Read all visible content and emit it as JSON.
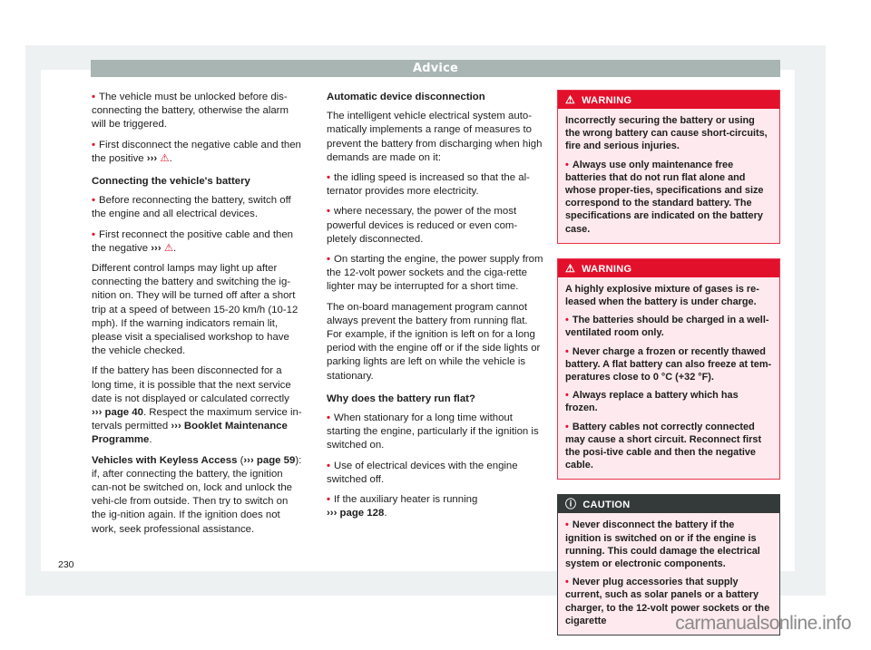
{
  "header": {
    "title": "Advice"
  },
  "left_column": {
    "bullets_top": [
      "The vehicle must be unlocked before dis-connecting the battery, otherwise the alarm will be triggered.",
      "First disconnect the negative cable and then the positive"
    ],
    "connecting_heading": "Connecting the vehicle's battery",
    "connecting_bullets": [
      "Before reconnecting the battery, switch off the engine and all electrical devices.",
      "First reconnect the positive cable and then the negative"
    ],
    "para_lamps": "Different control lamps may light up after connecting the battery and switching the ig-nition on. They will be turned off after a short trip at a speed of between 15-20 km/h (10-12 mph). If the warning indicators remain lit, please visit a specialised workshop to have the vehicle checked.",
    "para_service_1": "If the battery has been disconnected for a long time, it is possible that the next service date is not displayed or calculated correctly",
    "para_service_ref": "››› page 40",
    "para_service_2": ". Respect the maximum service in-tervals permitted",
    "para_service_ref2": "››› Booklet Maintenance Programme",
    "para_service_3": ".",
    "keyless_heading": "Vehicles with Keyless Access",
    "keyless_ref": "››› page 59",
    "keyless_text": "): if, after connecting the battery, the ignition can-not be switched on, lock and unlock the vehi-cle from outside. Then try to switch on the ig-nition again. If the ignition does not work, seek professional assistance.",
    "ref_arrow": "›››",
    "warn_symbol": "⚠"
  },
  "middle_column": {
    "auto_heading": "Automatic device disconnection",
    "auto_intro": "The intelligent vehicle electrical system auto-matically implements a range of measures to prevent the battery from discharging when high demands are made on it:",
    "auto_bullets": [
      "the idling speed is increased so that the al-ternator provides more electricity.",
      "where necessary, the power of the most powerful devices is reduced or even com-pletely disconnected.",
      "On starting the engine, the power supply from the 12-volt power sockets and the ciga-rette lighter may be interrupted for a short time."
    ],
    "mgmt_para": "The on-board management program cannot always prevent the battery from running flat. For example, if the ignition is left on for a long period with the engine off or if the side lights or parking lights are left on while the vehicle is stationary.",
    "flat_heading": "Why does the battery run flat?",
    "flat_bullets": [
      "When stationary for a long time without starting the engine, particularly if the ignition is switched on.",
      "Use of electrical devices with the engine switched off.",
      "If the auxiliary heater is running"
    ],
    "flat_ref": "››› page 128",
    "flat_ref_end": "."
  },
  "right_column": {
    "warning1": {
      "label": "WARNING",
      "icon": "⚠",
      "intro": "Incorrectly securing the battery or using the wrong battery can cause short-circuits, fire and serious injuries.",
      "bullets": [
        "Always use only maintenance free batteries that do not run flat alone and whose proper-ties, specifications and size correspond to the standard battery. The specifications are indicated on the battery case."
      ]
    },
    "warning2": {
      "label": "WARNING",
      "icon": "⚠",
      "intro": "A highly explosive mixture of gases is re-leased when the battery is under charge.",
      "bullets": [
        "The batteries should be charged in a well-ventilated room only.",
        "Never charge a frozen or recently thawed battery. A flat battery can also freeze at tem-peratures close to 0 °C (+32 °F).",
        "Always replace a battery which has frozen.",
        "Battery cables not correctly connected may cause a short circuit. Reconnect first the posi-tive cable and then the negative cable."
      ]
    },
    "caution": {
      "label": "CAUTION",
      "icon": "ⓘ",
      "bullets": [
        "Never disconnect the battery if the ignition is switched on or if the engine is running. This could damage the electrical system or electronic components.",
        "Never plug accessories that supply current, such as solar panels or a battery charger, to the 12-volt power sockets or the cigarette"
      ]
    }
  },
  "footer": {
    "page_number": "230",
    "watermark": "carmanualsonline.info"
  },
  "colors": {
    "accent_red": "#e3102b",
    "header_gray": "#a8b5b3",
    "caution_dark": "#343a3a",
    "box_bg": "#fde9ee"
  }
}
